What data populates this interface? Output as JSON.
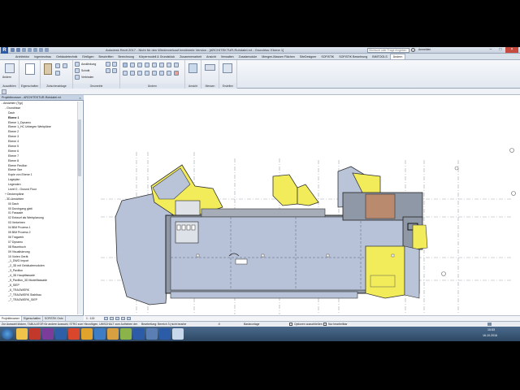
{
  "window": {
    "title": "Autodesk Revit 2017 - Nicht für den Wiederverkauf bestimmte Version - [ARCHITEKTUR-Rohdatei.rvt - Grundriss: Ebene 1]",
    "search_placeholder": "Stichwort oder Frage eingeben",
    "user": "Anmelden",
    "app_letter": "R"
  },
  "ribbon_tabs": [
    "Architektur",
    "Ingenieurbau",
    "Gebäudetechnik",
    "Einfügen",
    "Beschriften",
    "Berechnung",
    "Körpermodell & Grundstück",
    "Zusammenarbeit",
    "Ansicht",
    "Verwalten",
    "Zusatzmodule",
    "Mengen-Massen Flächen",
    "SiteDesigner",
    "SOFiSTiK",
    "SOFiSTiK Bewehrung",
    "BIMTOOLS",
    "Ändern"
  ],
  "active_tab": "Ändern",
  "ribbon_groups": {
    "select": {
      "button": "Ändern",
      "label": "Auswählen"
    },
    "properties": {
      "label": "Eigenschaften"
    },
    "clipboard": {
      "label": "Zwischenablage"
    },
    "geometry": {
      "items": [
        "Ausklinkung",
        "Schnitt",
        "Verbinden"
      ],
      "label": "Geometrie"
    },
    "modify": {
      "label": "Ändern"
    },
    "view": {
      "label": "Ansicht"
    },
    "measure": {
      "label": "Messen"
    },
    "create": {
      "label": "Erstellen"
    }
  },
  "project_browser": {
    "title": "Projektbrowser - ARCHITEKTUR-Rohdatei.rvt",
    "items": [
      {
        "text": "Ansichten (Typ)",
        "level": 0,
        "expander": "-"
      },
      {
        "text": "Grundrisse",
        "level": 1,
        "expander": "-"
      },
      {
        "text": "Dach",
        "level": 2
      },
      {
        "text": "Ebene 1",
        "level": 2,
        "bold": true
      },
      {
        "text": "Ebene 1_Dynamo",
        "level": 2
      },
      {
        "text": "Ebene 1_HC Unbegen Werkpläne",
        "level": 2
      },
      {
        "text": "Ebene 2",
        "level": 2
      },
      {
        "text": "Ebene 3",
        "level": 2
      },
      {
        "text": "Ebene 4",
        "level": 2
      },
      {
        "text": "Ebene 5",
        "level": 2
      },
      {
        "text": "Ebene 6",
        "level": 2
      },
      {
        "text": "Ebene 7",
        "level": 2
      },
      {
        "text": "Ebene 8",
        "level": 2
      },
      {
        "text": "Ebene Pavillon",
        "level": 2
      },
      {
        "text": "Ebene See",
        "level": 2
      },
      {
        "text": "Kopie von Ebene 1",
        "level": 2
      },
      {
        "text": "Lageplan",
        "level": 2
      },
      {
        "text": "Legenden",
        "level": 2
      },
      {
        "text": "Level 0 - Ground Floor",
        "level": 2
      },
      {
        "text": "Deckenpläne",
        "level": 1,
        "expander": "+"
      },
      {
        "text": "3D-Ansichten",
        "level": 1,
        "expander": "-"
      },
      {
        "text": "00 Dach",
        "level": 2
      },
      {
        "text": "00 Durchgang glatt",
        "level": 2
      },
      {
        "text": "01 Fassade",
        "level": 2
      },
      {
        "text": "02 Entwurf als Werkplanung",
        "level": 2
      },
      {
        "text": "03 Verkehren",
        "level": 2
      },
      {
        "text": "04 BIM Prozess 1",
        "level": 2
      },
      {
        "text": "05 BIM Prozess 2",
        "level": 2
      },
      {
        "text": "06 Tragwerk",
        "level": 2
      },
      {
        "text": "07 Dynamo",
        "level": 2
      },
      {
        "text": "08 Raumbuch",
        "level": 2
      },
      {
        "text": "09 Visualisierung",
        "level": 2
      },
      {
        "text": "10 Vorlen Gerät",
        "level": 2
      },
      {
        "text": "_1_DWG Import",
        "level": 2
      },
      {
        "text": "_2_3D mit Gebäudemodulen",
        "level": 2
      },
      {
        "text": "_3_Pavillon",
        "level": 2
      },
      {
        "text": "_4_3D Hauptfassade",
        "level": 2
      },
      {
        "text": "_5_Pavillon_3D Modellfassade",
        "level": 2
      },
      {
        "text": "_6_SIEP",
        "level": 2
      },
      {
        "text": "_6_TRAGWERK",
        "level": 2
      },
      {
        "text": "_7_TRAGWERK Stahlbau",
        "level": 2
      },
      {
        "text": "_7_TRAGWERK_SIEP",
        "level": 2
      }
    ]
  },
  "browser_tabs": [
    "Projektbrowser",
    "Eigenschaften",
    "SOFiSTiK Ordn"
  ],
  "view_control": {
    "scale": "1 : 100"
  },
  "status": {
    "hint": "Zur Auswahl klicken, TABULATOR für andere Auswahl, STRG zum Hinzufügen, UMSCHALT zum Aufheben der Auswahl.",
    "workset": "Bearbeitung: Bereich 3 (nicht bearbe",
    "zoom": ":0",
    "design_option": "Basisvorlage",
    "editable_only": "Optionen ausschließen",
    "pick": "Nur bearbeitbar"
  },
  "taskbar": {
    "time": "10:53",
    "date": "16.10.2016"
  },
  "colors": {
    "accent": "#2c5ca8",
    "floor": "#b7c2d8",
    "room_yellow": "#f2ec5a",
    "room_brown": "#b98a6e",
    "slab": "#8f98a6"
  }
}
